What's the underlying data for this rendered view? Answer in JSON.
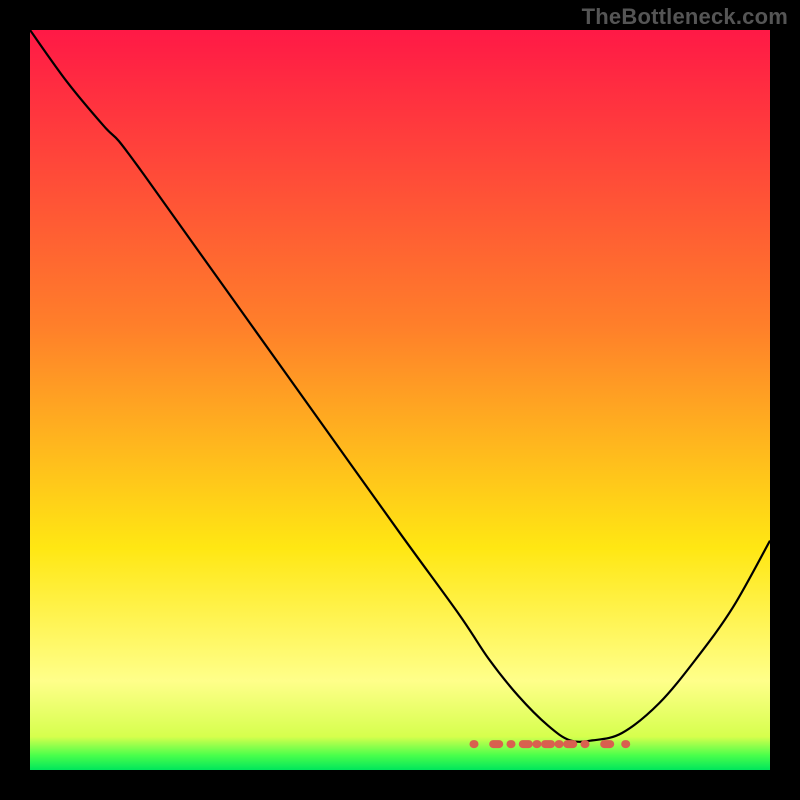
{
  "watermark": "TheBottleneck.com",
  "chart_data": {
    "type": "line",
    "title": "",
    "xlabel": "",
    "ylabel": "",
    "xlim": [
      0,
      100
    ],
    "ylim": [
      0,
      100
    ],
    "gradient_bg": {
      "stops": [
        {
          "pos": 0.0,
          "color": "#ff1946"
        },
        {
          "pos": 0.4,
          "color": "#ff7f2a"
        },
        {
          "pos": 0.7,
          "color": "#ffe713"
        },
        {
          "pos": 0.88,
          "color": "#ffff8a"
        },
        {
          "pos": 0.955,
          "color": "#d6ff4d"
        },
        {
          "pos": 0.98,
          "color": "#4bff4b"
        },
        {
          "pos": 1.0,
          "color": "#00e65c"
        }
      ]
    },
    "series": [
      {
        "name": "bottleneck-curve",
        "color": "#000000",
        "x": [
          0,
          5,
          10,
          12,
          15,
          20,
          30,
          40,
          50,
          58,
          62,
          66,
          70,
          73,
          76,
          80,
          85,
          90,
          95,
          100
        ],
        "y": [
          100,
          93,
          87,
          85,
          81,
          74,
          60,
          46,
          32,
          21,
          15,
          10,
          6,
          4,
          4,
          5,
          9,
          15,
          22,
          31
        ]
      }
    ],
    "marker_strip": {
      "name": "optimal-range-markers",
      "color": "#d9604f",
      "y": 3.5,
      "x_values": [
        60,
        63,
        65,
        67,
        68.5,
        70,
        71.5,
        73,
        75,
        78,
        80.5
      ]
    }
  }
}
